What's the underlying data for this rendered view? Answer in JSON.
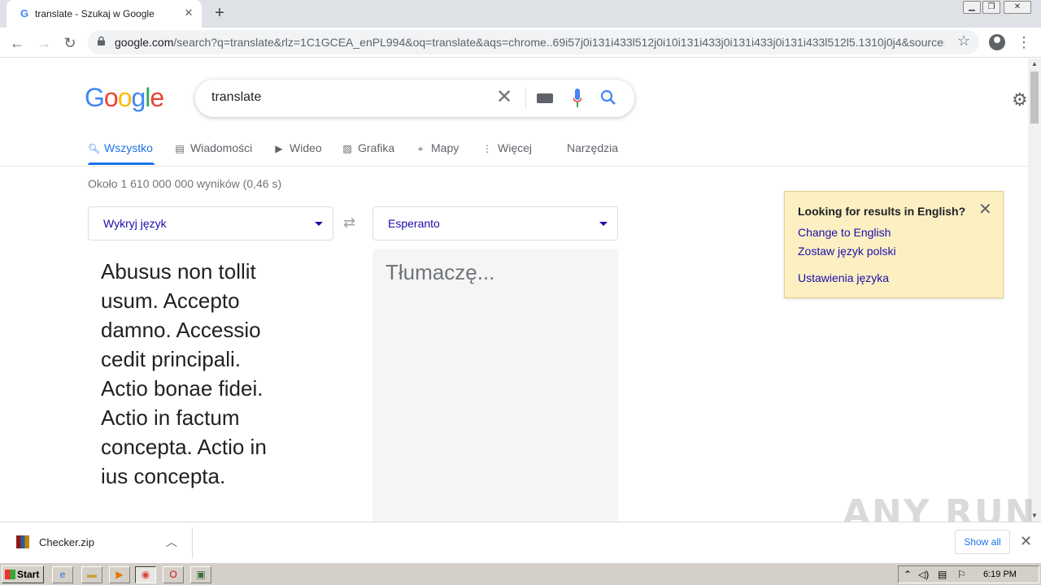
{
  "browser": {
    "tab_title": "translate - Szukaj w Google",
    "tab_favicon": "G",
    "url_domain": "google.com",
    "url_path": "/search?q=translate&rlz=1C1GCEA_enPL994&oq=translate&aqs=chrome..69i57j0i131i433l512j0i10i131i433j0i131i433j0i131i433l512l5.1310j0j4&sourceid=chrom..."
  },
  "google": {
    "logo": [
      "G",
      "o",
      "o",
      "g",
      "l",
      "e"
    ],
    "logo_colors": [
      "#4285f4",
      "#ea4335",
      "#fbbc05",
      "#4285f4",
      "#34a853",
      "#ea4335"
    ],
    "query": "translate",
    "tabs": [
      {
        "label": "Wszystko",
        "icon": "search-icon"
      },
      {
        "label": "Wiadomości",
        "icon": "news-icon"
      },
      {
        "label": "Wideo",
        "icon": "video-icon"
      },
      {
        "label": "Grafika",
        "icon": "image-icon"
      },
      {
        "label": "Mapy",
        "icon": "map-pin-icon"
      },
      {
        "label": "Więcej",
        "icon": "more-vert-icon"
      }
    ],
    "tools_label": "Narzędzia",
    "result_stats": "Około 1 610 000 000 wyników (0,46 s)"
  },
  "translate": {
    "source_lang": "Wykryj język",
    "target_lang": "Esperanto",
    "source_text": "Abusus non tollit usum. Accepto damno. Accessio cedit principali. Actio bonae fidei. Actio in factum concepta. Actio in ius concepta.",
    "target_placeholder": "Tłumaczę..."
  },
  "lang_notice": {
    "title": "Looking for results in English?",
    "change": "Change to English",
    "keep": "Zostaw język polski",
    "settings": "Ustawienia języka"
  },
  "download": {
    "file": "Checker.zip",
    "show_all": "Show all"
  },
  "watermark": "ANY RUN",
  "taskbar": {
    "start": "Start",
    "time": "6:19 PM"
  },
  "colors": {
    "link": "#1a0dab",
    "accent": "#1a73e8",
    "notice_bg": "#fcf0c3"
  }
}
